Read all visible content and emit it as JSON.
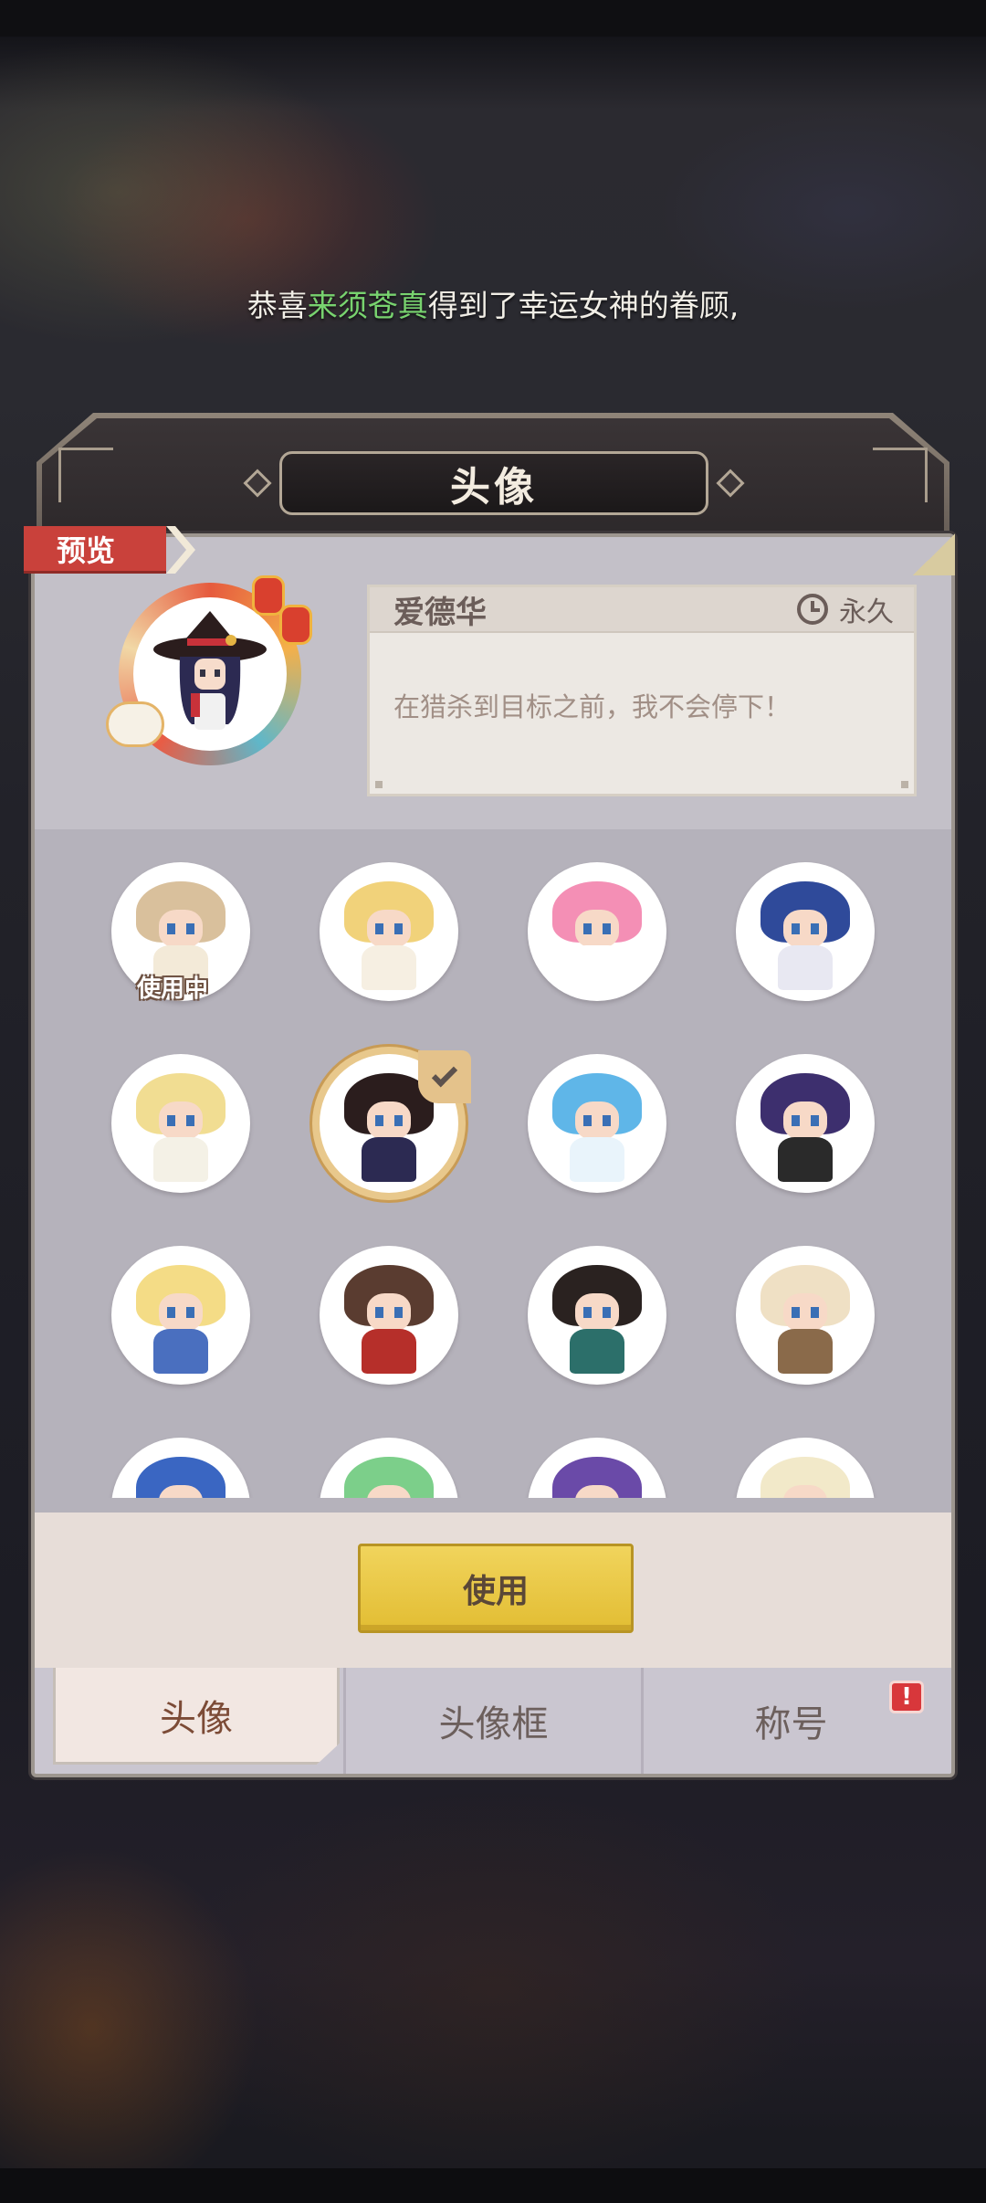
{
  "congrats": {
    "prefix": "恭喜",
    "player_name": "来须苍真",
    "suffix": "得到了幸运女神的眷顾,"
  },
  "panel": {
    "title": "头像"
  },
  "preview": {
    "tag": "预览",
    "character_name": "爱德华",
    "duration": "永久",
    "quote": "在猎杀到目标之前，我不会停下！"
  },
  "grid": {
    "in_use_label": "使用中",
    "avatars": [
      {
        "icon": "elf-girl-avatar",
        "in_use": true,
        "selected": false
      },
      {
        "icon": "angel-halo-girl-avatar",
        "in_use": false,
        "selected": false
      },
      {
        "icon": "pink-hair-girl-avatar",
        "in_use": false,
        "selected": false
      },
      {
        "icon": "blue-hood-girl-avatar",
        "in_use": false,
        "selected": false
      },
      {
        "icon": "blonde-horned-girl-avatar",
        "in_use": false,
        "selected": false
      },
      {
        "icon": "witch-hat-edward-avatar",
        "in_use": false,
        "selected": true
      },
      {
        "icon": "blue-twintail-girl-avatar",
        "in_use": false,
        "selected": false
      },
      {
        "icon": "purple-hair-swordsman-avatar",
        "in_use": false,
        "selected": false
      },
      {
        "icon": "blonde-knight-avatar",
        "in_use": false,
        "selected": false
      },
      {
        "icon": "horned-brown-hair-girl-avatar",
        "in_use": false,
        "selected": false
      },
      {
        "icon": "anubis-girl-avatar",
        "in_use": false,
        "selected": false
      },
      {
        "icon": "fox-ear-girl-avatar",
        "in_use": false,
        "selected": false
      },
      {
        "icon": "blue-dragon-avatar",
        "in_use": false,
        "selected": false
      },
      {
        "icon": "green-hair-avatar",
        "in_use": false,
        "selected": false
      },
      {
        "icon": "purple-hair-avatar",
        "in_use": false,
        "selected": false
      },
      {
        "icon": "bunny-ear-avatar",
        "in_use": false,
        "selected": false
      }
    ]
  },
  "actions": {
    "use_label": "使用"
  },
  "tabs": [
    {
      "label": "头像",
      "active": true
    },
    {
      "label": "头像框",
      "active": false
    },
    {
      "label": "称号",
      "active": false,
      "alert": "!"
    }
  ],
  "colors": {
    "accent_gold": "#e2bd33",
    "player_name_green": "#78d36f",
    "preview_tag_red": "#c9413b",
    "alert_red": "#d8373b"
  }
}
